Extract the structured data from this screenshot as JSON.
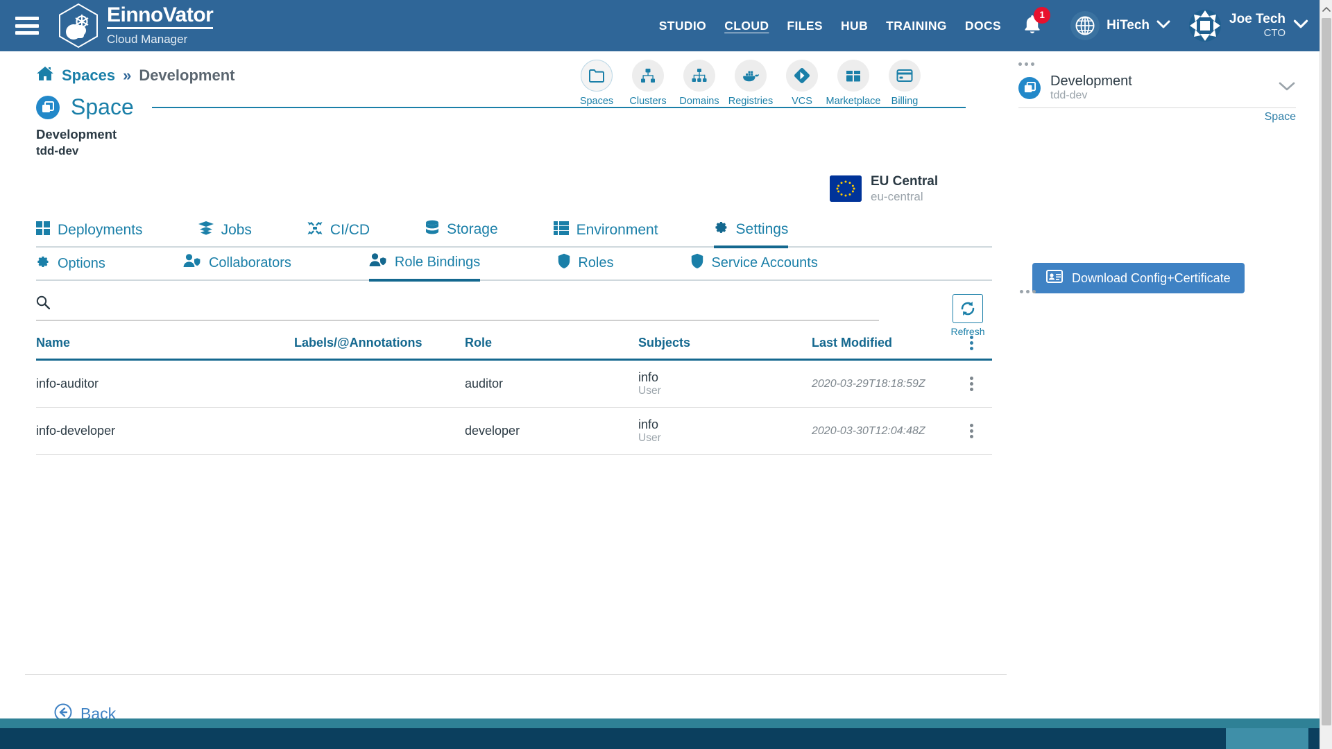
{
  "header": {
    "menu_icon": "hamburger-icon",
    "brand_name": "EinnoVator",
    "brand_sub": "Cloud Manager",
    "nav": [
      {
        "label": "STUDIO",
        "active": false
      },
      {
        "label": "CLOUD",
        "active": true
      },
      {
        "label": "FILES",
        "active": false
      },
      {
        "label": "HUB",
        "active": false
      },
      {
        "label": "TRAINING",
        "active": false
      },
      {
        "label": "DOCS",
        "active": false
      }
    ],
    "notification_count": "1",
    "org_name": "HiTech",
    "user_name": "Joe Tech",
    "user_role": "CTO"
  },
  "breadcrumb": {
    "home_icon": "home-icon",
    "root": "Spaces",
    "separator": "»",
    "current": "Development"
  },
  "page": {
    "title": "Space",
    "name": "Development",
    "slug": "tdd-dev"
  },
  "icon_toolbar": [
    {
      "label": "Spaces",
      "icon": "folder-icon",
      "selected": true
    },
    {
      "label": "Clusters",
      "icon": "cluster-nodes-icon",
      "selected": false
    },
    {
      "label": "Domains",
      "icon": "sitemap-icon",
      "selected": false
    },
    {
      "label": "Registries",
      "icon": "docker-whale-icon",
      "selected": false
    },
    {
      "label": "VCS",
      "icon": "git-diamond-icon",
      "selected": false
    },
    {
      "label": "Marketplace",
      "icon": "box-icon",
      "selected": false
    },
    {
      "label": "Billing",
      "icon": "credit-card-icon",
      "selected": false
    }
  ],
  "region": {
    "flag": "eu-flag-icon",
    "name": "EU Central",
    "slug": "eu-central"
  },
  "tabs_main": [
    {
      "label": "Deployments",
      "icon": "grid-icon",
      "active": false
    },
    {
      "label": "Jobs",
      "icon": "layers-icon",
      "active": false
    },
    {
      "label": "CI/CD",
      "icon": "arrows-in-icon",
      "active": false
    },
    {
      "label": "Storage",
      "icon": "database-icon",
      "active": false
    },
    {
      "label": "Environment",
      "icon": "list-grid-icon",
      "active": false
    },
    {
      "label": "Settings",
      "icon": "gear-icon",
      "active": true
    }
  ],
  "tabs_sub": [
    {
      "label": "Options",
      "icon": "gear-icon",
      "active": false
    },
    {
      "label": "Collaborators",
      "icon": "user-shield-icon",
      "active": false
    },
    {
      "label": "Role Bindings",
      "icon": "user-shield-icon",
      "active": true
    },
    {
      "label": "Roles",
      "icon": "shield-icon",
      "active": false
    },
    {
      "label": "Service Accounts",
      "icon": "shield-icon",
      "active": false
    }
  ],
  "search": {
    "icon": "search-icon",
    "value": "",
    "placeholder": ""
  },
  "refresh": {
    "icon": "refresh-icon",
    "label": "Refresh"
  },
  "table": {
    "columns": [
      "Name",
      "Labels/@Annotations",
      "Role",
      "Subjects",
      "Last Modified"
    ],
    "rows": [
      {
        "name": "info-auditor",
        "labels": "",
        "role": "auditor",
        "subject": "info",
        "subject_kind": "User",
        "last_modified": "2020-03-29T18:18:59Z"
      },
      {
        "name": "info-developer",
        "labels": "",
        "role": "developer",
        "subject": "info",
        "subject_kind": "User",
        "last_modified": "2020-03-30T12:04:48Z"
      }
    ]
  },
  "footer": {
    "back_label": "Back",
    "back_icon": "arrow-left-circle-icon"
  },
  "right_panel": {
    "card_title": "Development",
    "card_sub": "tdd-dev",
    "card_kind": "Space",
    "download_label": "Download Config+Certificate",
    "download_icon": "id-card-icon"
  },
  "colors": {
    "header_blue": "#2f6698",
    "accent_teal": "#1a7fa8",
    "badge_red": "#e8112d",
    "button_blue": "#3f82c4",
    "footer_navy": "#0b3f5e",
    "footer_teal": "#2f8196"
  }
}
